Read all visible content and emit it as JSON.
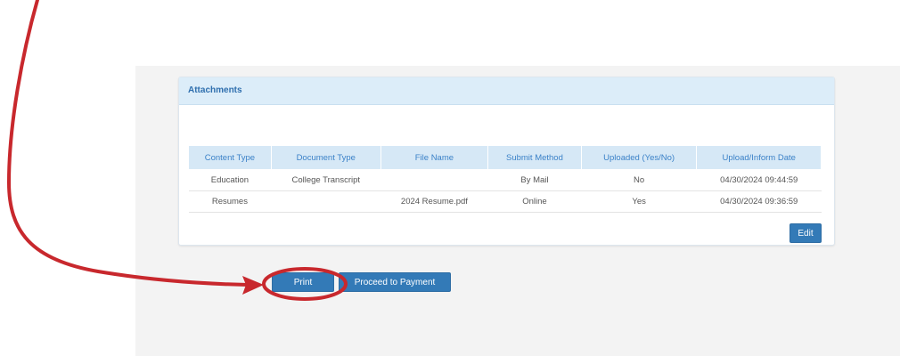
{
  "attachments": {
    "heading": "Attachments",
    "columns": [
      "Content Type",
      "Document Type",
      "File Name",
      "Submit Method",
      "Uploaded (Yes/No)",
      "Upload/Inform Date"
    ],
    "rows": [
      [
        "Education",
        "College Transcript",
        "",
        "By Mail",
        "No",
        "04/30/2024 09:44:59"
      ],
      [
        "Resumes",
        "",
        "2024 Resume.pdf",
        "Online",
        "Yes",
        "04/30/2024 09:36:59"
      ]
    ],
    "edit_label": "Edit"
  },
  "actions": {
    "print_label": "Print",
    "proceed_label": "Proceed to Payment"
  },
  "annotation": {
    "color": "#c8282d"
  }
}
